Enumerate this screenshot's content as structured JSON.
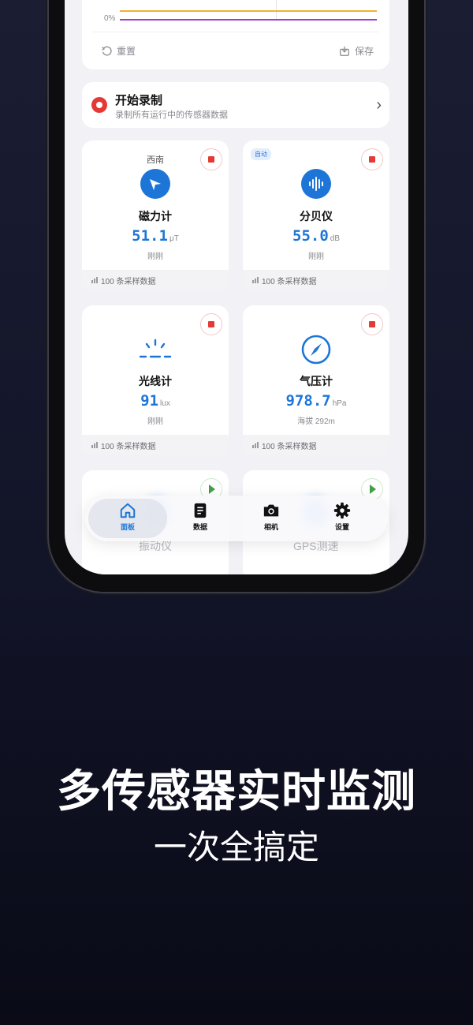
{
  "chart": {
    "axis_label": "0%",
    "reset_label": "重置",
    "save_label": "保存",
    "series_colors": [
      "#f0b429",
      "#9b3ec9"
    ]
  },
  "record": {
    "title": "开始录制",
    "subtitle": "录制所有运行中的传感器数据"
  },
  "sensors": [
    {
      "name": "磁力计",
      "direction": "西南",
      "value": "51.1",
      "unit": "μT",
      "time": "刚刚",
      "samples": "100 条采样数据",
      "icon": "compass-arrow-icon"
    },
    {
      "name": "分贝仪",
      "badge": "自动",
      "value": "55.0",
      "unit": "dB",
      "time": "刚刚",
      "samples": "100 条采样数据",
      "icon": "sound-wave-icon"
    },
    {
      "name": "光线计",
      "value": "91",
      "unit": "lux",
      "time": "刚刚",
      "samples": "100 条采样数据",
      "icon": "sunrise-icon"
    },
    {
      "name": "气压计",
      "value": "978.7",
      "unit": "hPa",
      "time": "海拔 292m",
      "samples": "100 条采样数据",
      "icon": "gauge-icon"
    }
  ],
  "hidden_sensors": [
    "振动仪",
    "GPS测速"
  ],
  "tabs": [
    {
      "label": "面板",
      "icon": "home-icon",
      "active": true
    },
    {
      "label": "数据",
      "icon": "document-icon"
    },
    {
      "label": "相机",
      "icon": "camera-icon"
    },
    {
      "label": "设置",
      "icon": "gear-icon"
    }
  ],
  "headline": {
    "title": "多传感器实时监测",
    "subtitle": "一次全搞定"
  },
  "colors": {
    "accent": "#1d76d7",
    "record": "#e53935",
    "play": "#43a047"
  }
}
